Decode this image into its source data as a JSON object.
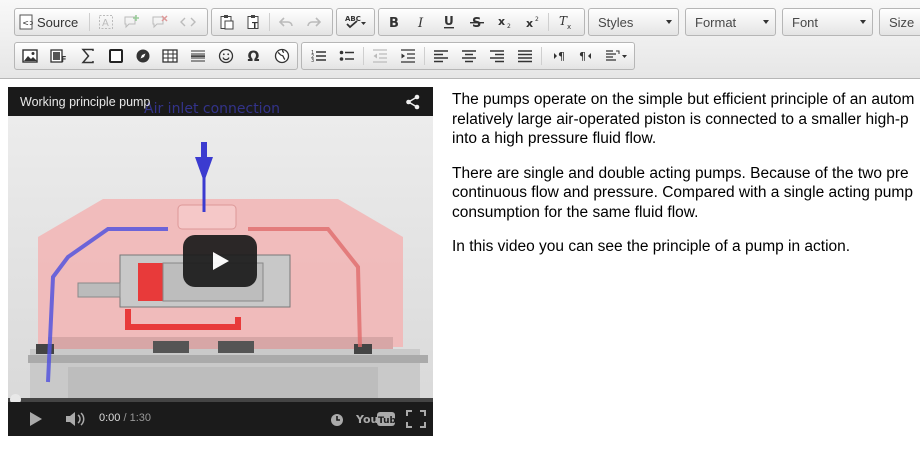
{
  "toolbar": {
    "source_label": "Source",
    "styles_label": "Styles",
    "format_label": "Format",
    "font_label": "Font",
    "size_label": "Size"
  },
  "video": {
    "title": "Working  principle pump",
    "annotation": "Air inlet connection",
    "current_time": "0:00",
    "separator": " / ",
    "duration": "1:30",
    "progress_fraction": 0
  },
  "article": {
    "lines_p1": [
      "The pumps operate on the simple but efficient principle of an autom",
      "relatively large air-operated piston is connected to a smaller high-p",
      "into a high pressure fluid flow."
    ],
    "lines_p2": [
      "There are single and double acting pumps. Because of the two pre",
      "continuous flow and pressure. Compared with a single acting pump",
      "consumption for the same fluid flow."
    ],
    "p3": "In this video you can see the principle of a pump in action."
  },
  "colors": {
    "toolbar_bg": "#eaeaea",
    "video_bg": "#1b1b1b",
    "pump_red": "#e84545",
    "pipe_blue": "#3b3bd0"
  }
}
